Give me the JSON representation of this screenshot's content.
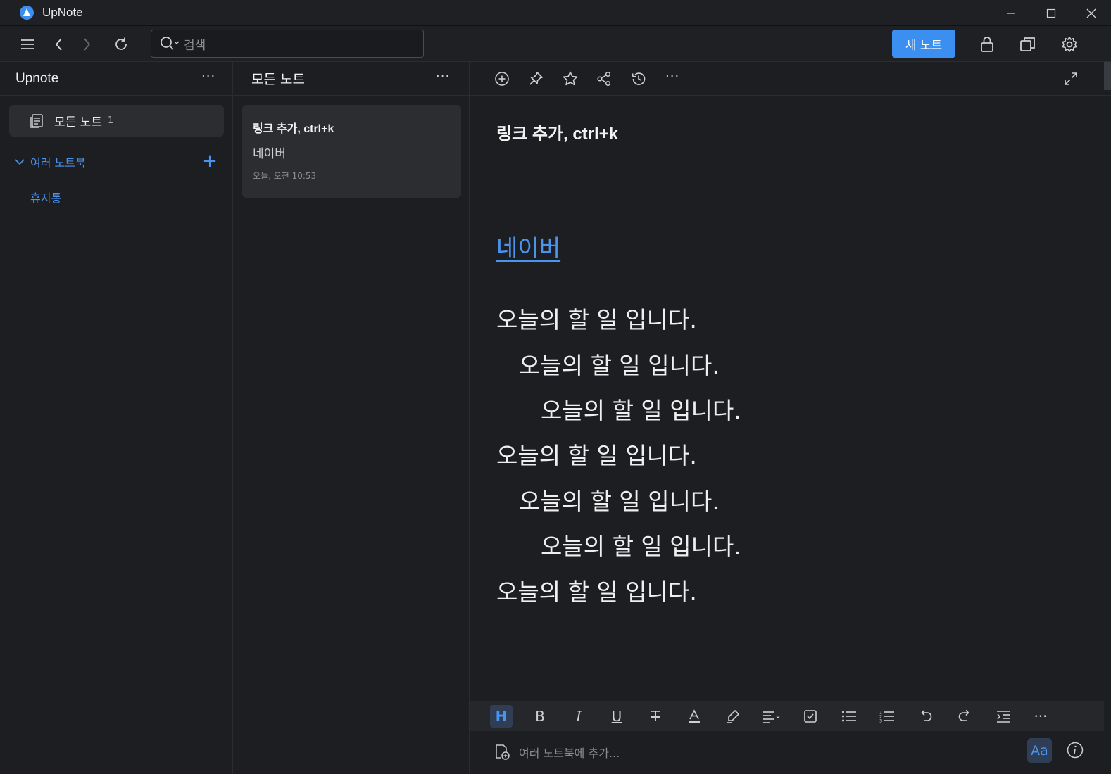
{
  "app": {
    "title": "UpNote"
  },
  "toolbar": {
    "search_placeholder": "검색",
    "new_note_label": "새 노트"
  },
  "sidebar": {
    "title": "Upnote",
    "more": "···",
    "all_notes_label": "모든 노트",
    "all_notes_count": "1",
    "notebooks_label": "여러 노트북",
    "add_notebook": "+",
    "trash_label": "휴지통"
  },
  "note_list": {
    "title": "모든 노트",
    "more": "···",
    "notes": [
      {
        "title": "링크 추가, ctrl+k",
        "snippet": "네이버",
        "date": "오늘, 오전 10:53"
      }
    ]
  },
  "editor": {
    "more": "···",
    "note_title": "링크 추가, ctrl+k",
    "link_text": "네이버",
    "lines": [
      "오늘의 할 일 입니다.",
      "오늘의 할 일 입니다.",
      "오늘의 할 일 입니다.",
      "오늘의 할 일 입니다.",
      "오늘의 할 일 입니다.",
      "오늘의 할 일 입니다.",
      "오늘의 할 일 입니다."
    ],
    "format_bar": {
      "heading": "H",
      "bold": "B",
      "italic": "I",
      "underline": "U",
      "strike": "T",
      "more": "···"
    },
    "footer": {
      "add_to_notebook_placeholder": "여러 노트북에 추가...",
      "font_button": "Aa"
    }
  },
  "colors": {
    "accent": "#3b8ff0",
    "link": "#4a93ee",
    "background": "#1d1e21",
    "panel": "#2c2d31"
  }
}
